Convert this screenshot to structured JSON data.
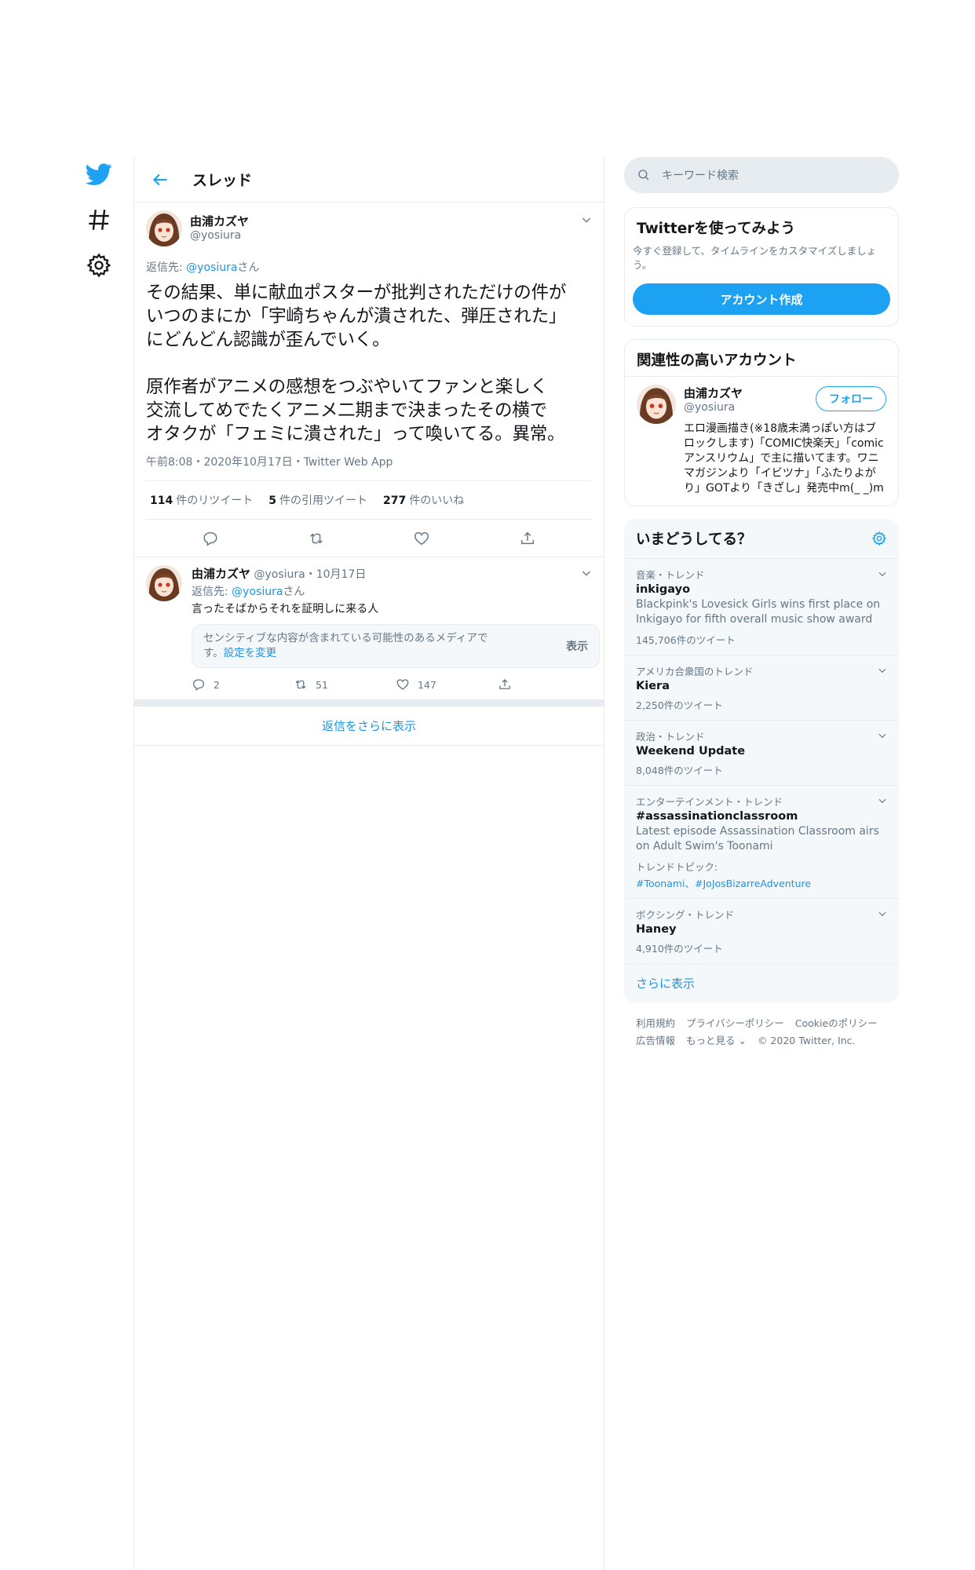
{
  "header": {
    "title": "スレッド"
  },
  "tweet": {
    "author_name": "由浦カズヤ",
    "author_handle": "@yosiura",
    "reply_label": "返信先: ",
    "reply_handle": "@yosiura",
    "reply_suffix": "さん",
    "text": "その結果、単に献血ポスターが批判されただけの件が\nいつのまにか「宇崎ちゃんが潰された、弾圧された」\nにどんどん認識が歪んでいく。\n\n原作者がアニメの感想をつぶやいてファンと楽しく\n交流してめでたくアニメ二期まで決まったその横で\nオタクが「フェミに潰された」って喚いてる。異常。",
    "meta": "午前8:08・2020年10月17日・Twitter Web App",
    "retweets_count": "114",
    "retweets_label": "件のリツイート",
    "quotes_count": "5",
    "quotes_label": "件の引用ツイート",
    "likes_count": "277",
    "likes_label": "件のいいね"
  },
  "reply": {
    "author_name": "由浦カズヤ",
    "author_handle_date": "@yosiura・10月17日",
    "reply_label": "返信先: ",
    "reply_handle": "@yosiura",
    "reply_suffix": "さん",
    "text": "言ったそばからそれを証明しに来る人",
    "sensitive_text": "センシティブな内容が含まれている可能性のあるメディアで\nす。",
    "sensitive_link": "設定を変更",
    "show_label": "表示",
    "reply_count": "2",
    "retweet_count": "51",
    "like_count": "147"
  },
  "more_replies": "返信をさらに表示",
  "search": {
    "placeholder": "キーワード検索"
  },
  "signup": {
    "title": "Twitterを使ってみよう",
    "subtitle": "今すぐ登録して、タイムラインをカスタマイズしましょう。",
    "button": "アカウント作成"
  },
  "related": {
    "title": "関連性の高いアカウント",
    "name": "由浦カズヤ",
    "handle": "@yosiura",
    "follow": "フォロー",
    "bio": "エロ漫画描き(※18歳未満っぽい方はブロックします)「COMIC快楽天」「comicアンスリウム」で主に描いてます。ワニマガジンより「イビツナ」「ふたりよがり」GOTより「きざし」発売中m(_ _)m"
  },
  "trends": {
    "title": "いまどうしてる？",
    "items": [
      {
        "category": "音楽・トレンド",
        "name": "inkigayo",
        "desc": "Blackpink's Lovesick Girls wins first place on Inkigayo for fifth overall music show award",
        "count": "145,706件のツイート"
      },
      {
        "category": "アメリカ合衆国のトレンド",
        "name": "Kiera",
        "count": "2,250件のツイート"
      },
      {
        "category": "政治・トレンド",
        "name": "Weekend Update",
        "count": "8,048件のツイート"
      },
      {
        "category": "エンターテインメント・トレンド",
        "name": "#assassinationclassroom",
        "desc": "Latest episode Assassination Classroom airs on Adult Swim's Toonami",
        "topic_label": "トレンドトピック:",
        "topics": "#Toonami、#JoJosBizarreAdventure"
      },
      {
        "category": "ボクシング・トレンド",
        "name": "Haney",
        "count": "4,910件のツイート"
      }
    ],
    "show_more": "さらに表示"
  },
  "footer": {
    "line1": [
      "利用規約",
      "プライバシーポリシー",
      "Cookieのポリシー"
    ],
    "line2": [
      "広告情報",
      "もっと見る ⌄",
      "© 2020 Twitter, Inc."
    ]
  },
  "colors": {
    "accent": "#1da1f2",
    "link": "#1b95e0",
    "muted": "#657786",
    "border": "#e6ecf0"
  }
}
